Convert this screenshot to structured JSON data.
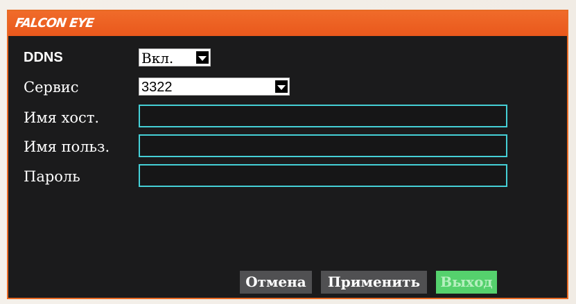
{
  "header": {
    "logo_text": "FALCON EYE",
    "color": "#e9581c"
  },
  "form": {
    "ddns": {
      "label": "DDNS",
      "value": "Вкл."
    },
    "service": {
      "label": "Сервис",
      "value": "3322"
    },
    "hostname": {
      "label": "Имя хост.",
      "value": ""
    },
    "username": {
      "label": "Имя польз.",
      "value": ""
    },
    "password": {
      "label": "Пароль",
      "value": ""
    }
  },
  "buttons": {
    "cancel": "Отмена",
    "apply": "Применить",
    "exit": "Выход"
  },
  "colors": {
    "accent": "#e9581c",
    "field_border": "#45d0d7",
    "exit_button": "#55d16d"
  }
}
